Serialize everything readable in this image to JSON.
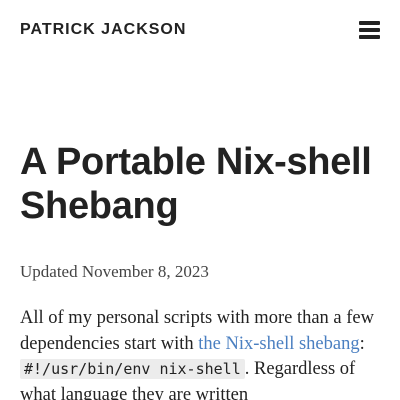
{
  "header": {
    "site_title": "PATRICK JACKSON",
    "menu_icon": "hamburger-menu-icon"
  },
  "post": {
    "title": "A Portable Nix-shell Shebang",
    "updated": "Updated November 8, 2023",
    "paragraph": {
      "text_before_link": "All of my personal scripts with more than a few dependencies start with ",
      "link_text": "the Nix-shell shebang",
      "text_after_link": ": ",
      "code": "#!/usr/bin/env nix-shell",
      "text_after_code": ". Regardless of what language they are written"
    }
  },
  "colors": {
    "text": "#222222",
    "link": "#4a7fc1",
    "code_background": "#ececec"
  }
}
